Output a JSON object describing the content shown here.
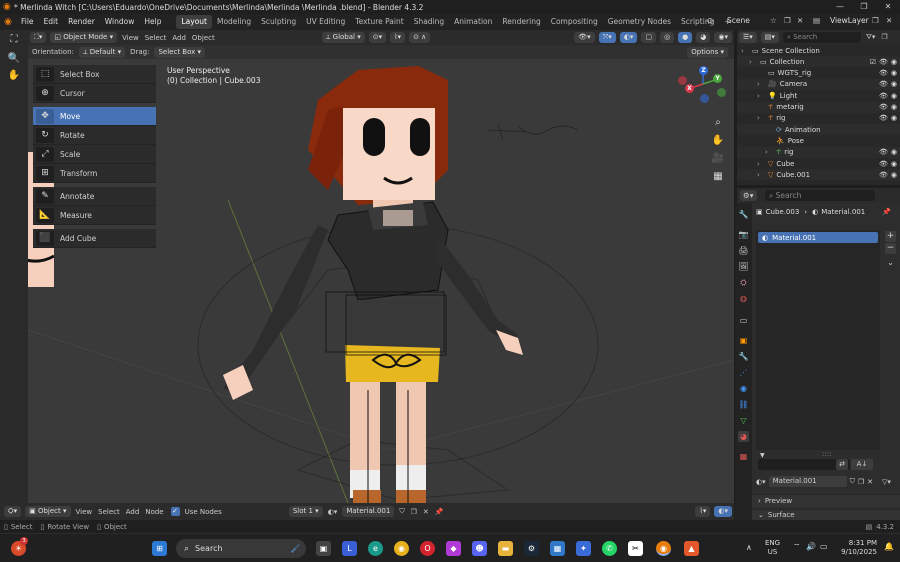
{
  "window": {
    "title": "* Merlinda Witch [C:\\Users\\Eduardo\\OneDrive\\Documents\\Merlinda\\Merlinda      \\Merlinda      .blend] - Blender 4.3.2"
  },
  "menubar": {
    "menus": [
      "File",
      "Edit",
      "Render",
      "Window",
      "Help"
    ],
    "workspaces": [
      "Layout",
      "Modeling",
      "Sculpting",
      "UV Editing",
      "Texture Paint",
      "Shading",
      "Animation",
      "Rendering",
      "Compositing",
      "Geometry Nodes",
      "Scripting"
    ],
    "active_workspace": "Layout",
    "add_workspace": "+",
    "scene": "Scene",
    "view_layer": "ViewLayer"
  },
  "viewport_header": {
    "mode": "Object Mode",
    "menus": [
      "View",
      "Select",
      "Add",
      "Object"
    ],
    "transform": "Global",
    "orientation_label": "Orientation:",
    "orientation_value": "Default",
    "drag_label": "Drag:",
    "drag_value": "Select Box",
    "options": "Options"
  },
  "tool_menu": [
    {
      "label": "Select Box",
      "icon": "select-box-icon",
      "glyph": "⬚",
      "active": false
    },
    {
      "label": "Cursor",
      "icon": "cursor-icon",
      "glyph": "⊕",
      "active": false
    },
    {
      "label": "Move",
      "icon": "move-icon",
      "glyph": "✥",
      "active": true
    },
    {
      "label": "Rotate",
      "icon": "rotate-icon",
      "glyph": "↻",
      "active": false
    },
    {
      "label": "Scale",
      "icon": "scale-icon",
      "glyph": "⤢",
      "active": false
    },
    {
      "label": "Transform",
      "icon": "transform-icon",
      "glyph": "⊞",
      "active": false
    },
    {
      "label": "Annotate",
      "icon": "annotate-icon",
      "glyph": "✎",
      "active": false
    },
    {
      "label": "Measure",
      "icon": "measure-icon",
      "glyph": "📐",
      "active": false
    },
    {
      "label": "Add Cube",
      "icon": "add-cube-icon",
      "glyph": "⬛",
      "active": false
    }
  ],
  "viewport_info": {
    "perspective": "User Perspective",
    "collection": "(0) Collection | Cube.003"
  },
  "gizmo": {
    "x": "X",
    "y": "Y",
    "z": "Z"
  },
  "bottom_editor": {
    "type": "Object",
    "menus": [
      "View",
      "Select",
      "Add",
      "Node"
    ],
    "use_nodes": "Use Nodes",
    "slot": "Slot 1",
    "material": "Material.001"
  },
  "statusbar": {
    "select": "Select",
    "rotate_view": "Rotate View",
    "object": "Object",
    "version": "4.3.2"
  },
  "outliner": {
    "search_placeholder": "Search",
    "rows": [
      {
        "name": "Scene Collection",
        "depth": 0,
        "icon": "collection-icon"
      },
      {
        "name": "Collection",
        "depth": 1,
        "icon": "collection-icon"
      },
      {
        "name": "WGTS_rig",
        "depth": 2,
        "icon": "collection-icon"
      },
      {
        "name": "Camera",
        "depth": 2,
        "icon": "camera-icon"
      },
      {
        "name": "Light",
        "depth": 2,
        "icon": "light-icon"
      },
      {
        "name": "metarig",
        "depth": 2,
        "icon": "armature-icon"
      },
      {
        "name": "rig",
        "depth": 2,
        "icon": "armature-icon"
      },
      {
        "name": "Animation",
        "depth": 3,
        "icon": "animation-icon"
      },
      {
        "name": "Pose",
        "depth": 3,
        "icon": "pose-icon"
      },
      {
        "name": "rig",
        "depth": 3,
        "icon": "armature-data-icon"
      },
      {
        "name": "Cube",
        "depth": 2,
        "icon": "mesh-icon"
      },
      {
        "name": "Cube.001",
        "depth": 2,
        "icon": "mesh-icon"
      }
    ]
  },
  "properties": {
    "search_placeholder": "Search",
    "object_name": "Cube.003",
    "material_name": "Material.001",
    "slot_item": "Material.001",
    "material_field": "Material.001",
    "panels": [
      "Preview",
      "Surface"
    ]
  },
  "taskbar": {
    "search_placeholder": "Search",
    "lang": "ENG",
    "region": "US",
    "time": "8:31 PM",
    "date": "9/10/2025",
    "weather_badge": "3"
  },
  "colors": {
    "accent": "#4772b3",
    "header": "#2b2b2b",
    "viewport": "#3a3a3a"
  }
}
